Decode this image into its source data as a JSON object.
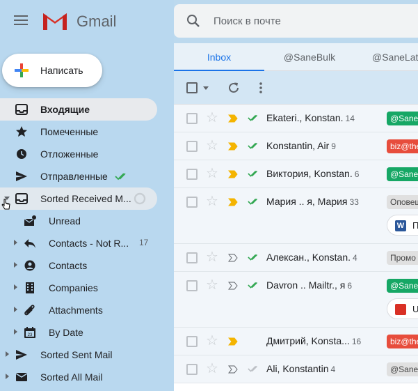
{
  "app": {
    "logo_text": "Gmail"
  },
  "compose": {
    "label": "Написать"
  },
  "search": {
    "placeholder": "Поиск в почте"
  },
  "nav": [
    {
      "label": "Входящие",
      "icon": "inbox-icon"
    },
    {
      "label": "Помеченные",
      "icon": "star-icon"
    },
    {
      "label": "Отложенные",
      "icon": "clock-icon"
    },
    {
      "label": "Отправленные",
      "icon": "send-icon"
    },
    {
      "label": "Sorted Received M...",
      "icon": "inbox-icon"
    },
    {
      "label": "Unread",
      "icon": "mail-unread-icon"
    },
    {
      "label": "Contacts - Not R...",
      "icon": "reply-icon",
      "count": "17"
    },
    {
      "label": "Contacts",
      "icon": "person-icon"
    },
    {
      "label": "Companies",
      "icon": "building-icon"
    },
    {
      "label": "Attachments",
      "icon": "paperclip-icon"
    },
    {
      "label": "By Date",
      "icon": "calendar-icon",
      "calendar_day": "23"
    },
    {
      "label": "Sorted Sent Mail",
      "icon": "send-icon"
    },
    {
      "label": "Sorted All Mail",
      "icon": "mail-icon"
    }
  ],
  "tabs": [
    "Inbox",
    "@SaneBulk",
    "@SaneLat"
  ],
  "emails": [
    {
      "sender": "Ekateri., Konstan.",
      "count": "14",
      "chip": "@SaneB",
      "chip_color": "green",
      "important": true
    },
    {
      "sender": "Konstantin, Air",
      "count": "9",
      "chip": "biz@the",
      "chip_color": "red",
      "important": true
    },
    {
      "sender": "Виктория, Konstan.",
      "count": "6",
      "chip": "@SaneB",
      "chip_color": "green",
      "important": true
    },
    {
      "sender": "Мария .. я, Мария",
      "count": "33",
      "chip": "Оповещ",
      "chip_color": "grey",
      "important": true,
      "attachment": {
        "badge": "W",
        "badge_color": "#2b579a",
        "text": "П"
      }
    },
    {
      "sender": "Алексан., Konstan.",
      "count": "4",
      "chip": "Промо",
      "chip_color": "grey",
      "important": false
    },
    {
      "sender": "Davron .. Mailtr., я",
      "count": "6",
      "chip": "@SaneB",
      "chip_color": "green",
      "important": false,
      "attachment": {
        "badge": "",
        "badge_color": "#d93025",
        "text": "U"
      }
    },
    {
      "sender": "Дмитрий, Konsta...",
      "count": "16",
      "chip": "biz@the",
      "chip_color": "red",
      "important": true
    },
    {
      "sender": "Ali, Konstantin",
      "count": "4",
      "chip": "@SaneL",
      "chip_color": "grey",
      "important": false
    }
  ]
}
